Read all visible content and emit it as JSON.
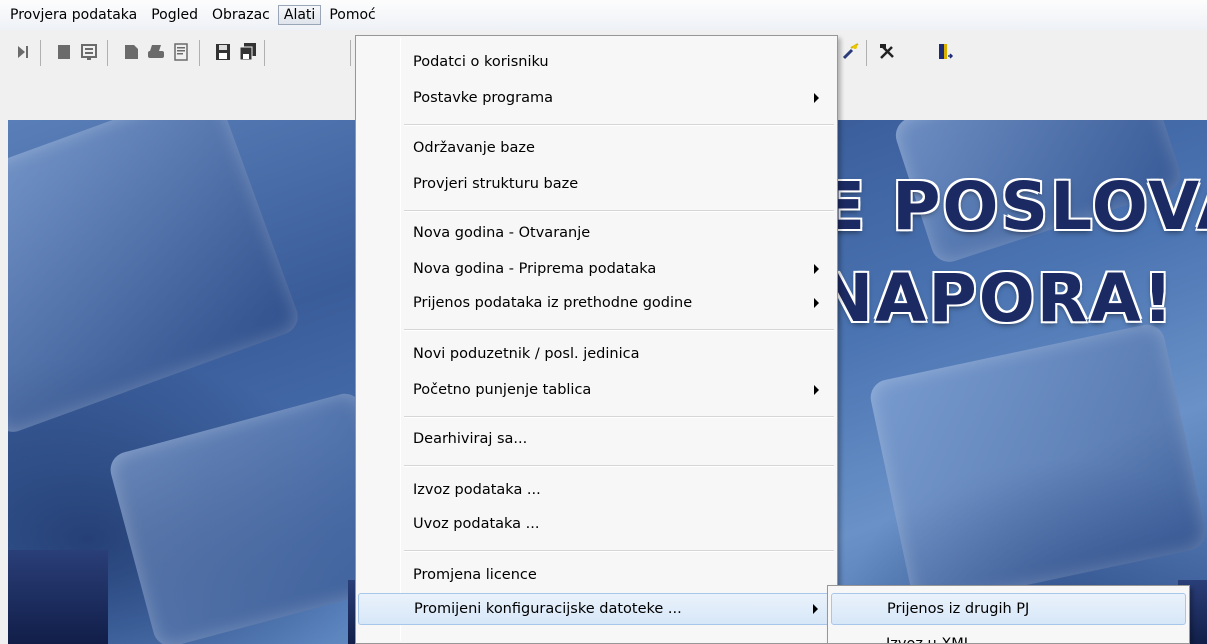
{
  "menubar": {
    "items": [
      "Provjera podataka",
      "Pogled",
      "Obrazac",
      "Alati",
      "Pomoć"
    ],
    "active_index": 3
  },
  "toolbar": {
    "icons": [
      "next-icon",
      "document-icon",
      "form-icon",
      "page-icon",
      "print-icon",
      "preview-icon",
      "save-icon",
      "save-all-icon",
      "wizard-icon",
      "tools-icon",
      "exit-icon"
    ]
  },
  "splash": {
    "headline_line1": "E POSLOVA",
    "headline_line2": "NAPORA!"
  },
  "dropdown": {
    "items": [
      {
        "label": "Podatci o korisniku",
        "submenu": false
      },
      {
        "label": "Postavke programa",
        "submenu": true
      },
      {
        "label": "Održavanje baze",
        "submenu": false
      },
      {
        "label": "Provjeri strukturu baze",
        "submenu": false
      },
      {
        "label": "Nova godina - Otvaranje",
        "submenu": false
      },
      {
        "label": "Nova godina - Priprema podataka",
        "submenu": true
      },
      {
        "label": "Prijenos podataka iz prethodne godine",
        "submenu": true
      },
      {
        "label": "Novi poduzetnik / posl. jedinica",
        "submenu": false
      },
      {
        "label": "Početno punjenje tablica",
        "submenu": true
      },
      {
        "label": "Dearhiviraj sa...",
        "submenu": false
      },
      {
        "label": "Izvoz podataka ...",
        "submenu": false
      },
      {
        "label": "Uvoz podataka ...",
        "submenu": false
      },
      {
        "label": "Promjena licence",
        "submenu": false
      },
      {
        "label": "Promijeni konfiguracijske datoteke ...",
        "submenu": true,
        "highlighted": true
      }
    ]
  },
  "submenu": {
    "items": [
      {
        "label": "Prijenos iz drugih PJ",
        "highlighted": true
      },
      {
        "label": "Izvoz u XML"
      }
    ]
  },
  "colors": {
    "highlight": "#d7e7f8",
    "menu_bg": "#f7f7f7",
    "headline": "#1c2a63"
  }
}
